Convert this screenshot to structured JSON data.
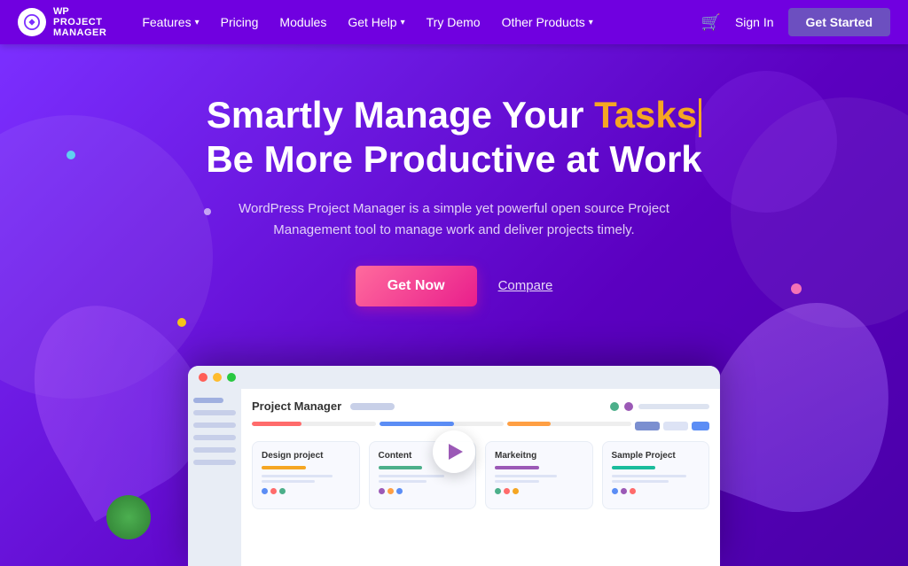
{
  "nav": {
    "logo_wp": "WP",
    "logo_project": "PROJECT",
    "logo_manager": "MANAGER",
    "items": [
      {
        "label": "Features",
        "has_dropdown": true
      },
      {
        "label": "Pricing",
        "has_dropdown": false
      },
      {
        "label": "Modules",
        "has_dropdown": false
      },
      {
        "label": "Get Help",
        "has_dropdown": true
      },
      {
        "label": "Try Demo",
        "has_dropdown": false
      },
      {
        "label": "Other Products",
        "has_dropdown": true
      }
    ],
    "cart_icon": "🛒",
    "sign_in": "Sign In",
    "get_started": "Get Started"
  },
  "hero": {
    "title_part1": "Smartly Manage Your ",
    "title_highlight": "Tasks",
    "title_part2": "Be More Productive at Work",
    "subtitle": "WordPress Project Manager is a simple yet powerful open source Project Management tool to manage work and deliver projects timely.",
    "btn_get_now": "Get Now",
    "btn_compare": "Compare"
  },
  "dashboard": {
    "title": "Project Manager",
    "cards": [
      {
        "title": "Design project",
        "bar_class": "cbar-orange",
        "dots": [
          "#5b8df5",
          "#ff6b6b",
          "#4caf8a"
        ]
      },
      {
        "title": "Content",
        "bar_class": "cbar-green",
        "dots": [
          "#9b59b6",
          "#ff9f43",
          "#5b8df5"
        ]
      },
      {
        "title": "Markeitng",
        "bar_class": "cbar-purple",
        "dots": [
          "#4caf8a",
          "#ff6b6b",
          "#f5a623"
        ]
      },
      {
        "title": "Sample Project",
        "bar_class": "cbar-teal",
        "dots": [
          "#5b8df5",
          "#9b59b6",
          "#ff6b6b"
        ]
      }
    ]
  }
}
